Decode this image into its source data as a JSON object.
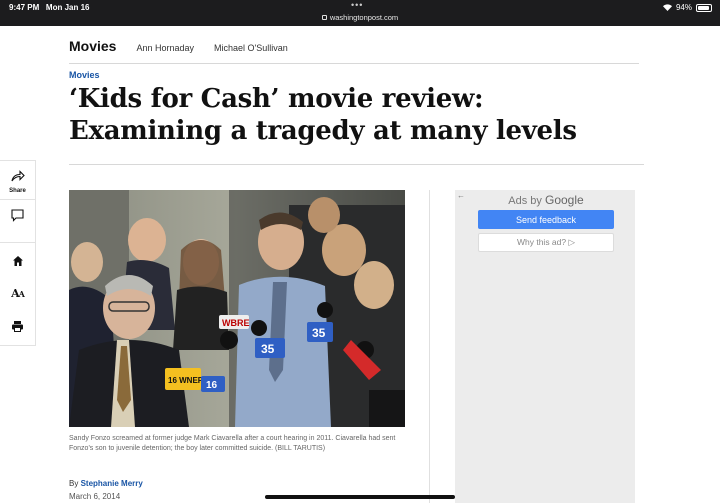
{
  "status_bar": {
    "time": "9:47 PM",
    "date": "Mon Jan 16",
    "url": "washingtonpost.com",
    "battery": "94%",
    "battery_level": 0.94
  },
  "section_nav": {
    "title": "Movies",
    "links": [
      "Ann Hornaday",
      "Michael O'Sullivan"
    ]
  },
  "article": {
    "kicker": "Movies",
    "headline": "‘Kids for Cash’ movie review: Examining a tragedy at many levels",
    "caption": "Sandy Fonzo screamed at former judge Mark Ciavarella after a court hearing in 2011. Ciavarella had sent Fonzo's son to juvenile detention; the boy later committed suicide. (BILL TARUTIS)",
    "byline_prefix": "By",
    "author": "Stephanie Merry",
    "date": "March 6, 2014"
  },
  "share_rail": {
    "share_label": "Share",
    "icons": [
      "share-icon",
      "comment-icon",
      "home-icon",
      "text-size-icon",
      "print-icon"
    ]
  },
  "photo": {
    "mic_labels": [
      "16 WNEP",
      "WBRE",
      "35",
      "35",
      "16"
    ]
  },
  "ad": {
    "ads_by": "Ads by",
    "google": "Google",
    "send_feedback": "Send feedback",
    "why_this_ad": "Why this ad? ▷"
  },
  "colors": {
    "accent_blue": "#1955a5",
    "google_blue": "#4285f4",
    "status_bar_bg": "#1c1c1e"
  }
}
